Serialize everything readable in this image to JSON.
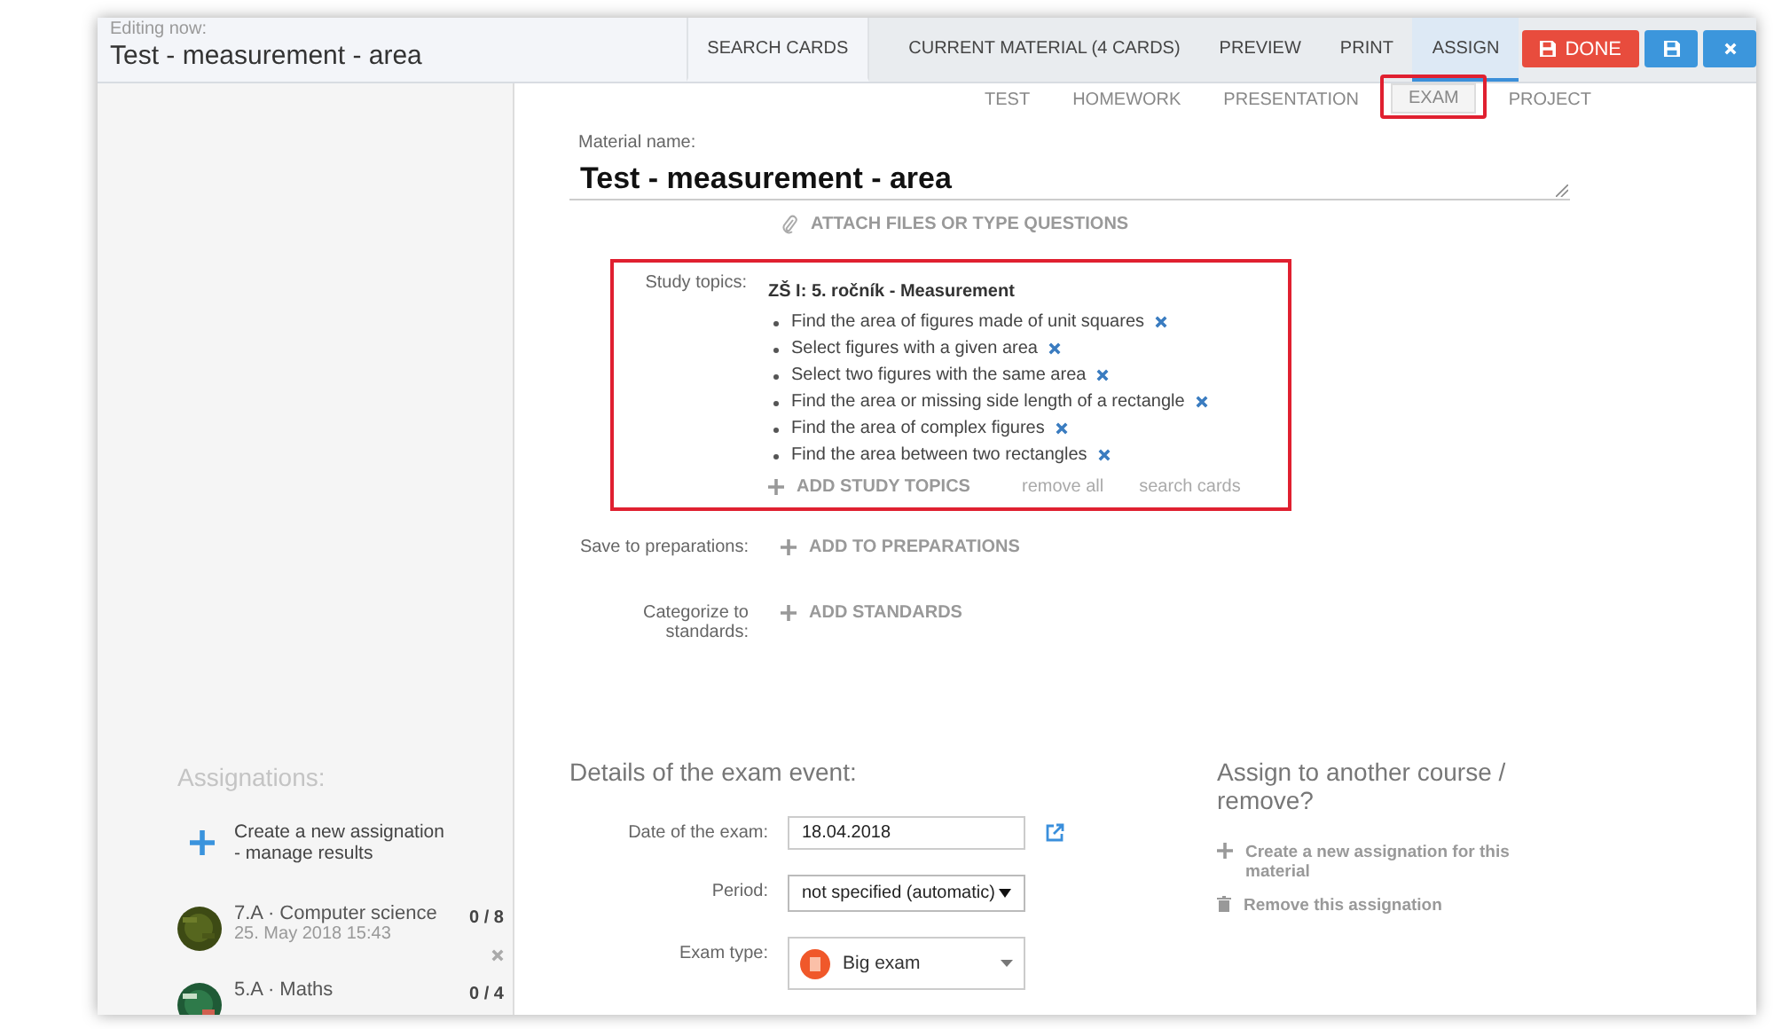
{
  "header": {
    "caption": "Editing now:",
    "title": "Test - measurement - area"
  },
  "nav_tabs": [
    {
      "label": "SEARCH CARDS",
      "selected": false
    },
    {
      "label": "CURRENT MATERIAL (4 CARDS)",
      "selected": false
    },
    {
      "label": "PREVIEW",
      "selected": false
    },
    {
      "label": "PRINT",
      "selected": false
    },
    {
      "label": "ASSIGN",
      "selected": true
    }
  ],
  "actions": {
    "done": "DONE"
  },
  "material_types": [
    {
      "label": "TEST",
      "selected": false
    },
    {
      "label": "HOMEWORK",
      "selected": false
    },
    {
      "label": "PRESENTATION",
      "selected": false
    },
    {
      "label": "EXAM",
      "selected": true
    },
    {
      "label": "PROJECT",
      "selected": false
    }
  ],
  "material_name": {
    "label": "Material name:",
    "value": "Test - measurement - area"
  },
  "attach": "ATTACH FILES OR TYPE QUESTIONS",
  "study_topics": {
    "label": "Study topics:",
    "group": "ZŠ I: 5. ročník - Measurement",
    "topics": [
      "Find the area of figures made of unit squares",
      "Select figures with a given area",
      "Select two figures with the same area",
      "Find the area or missing side length of a rectangle",
      "Find the area of complex figures",
      "Find the area between two rectangles"
    ],
    "add": "ADD STUDY TOPICS",
    "remove_all": "remove all",
    "search": "search cards"
  },
  "preparations": {
    "label": "Save to preparations:",
    "action": "ADD TO PREPARATIONS"
  },
  "standards": {
    "label": "Categorize to standards:",
    "action": "ADD STANDARDS"
  },
  "assignations": {
    "title": "Assignations:",
    "create": "Create a new assignation - manage results",
    "items": [
      {
        "name": "7.A · Computer science",
        "date": "25. May 2018 15:43",
        "score": "0 / 8"
      },
      {
        "name": "5.A · Maths",
        "score": "0 / 4"
      }
    ]
  },
  "exam_event": {
    "title": "Details of the exam event:",
    "date": {
      "label": "Date of the exam:",
      "value": "18.04.2018"
    },
    "period": {
      "label": "Period:",
      "value": "not specified (automatic)"
    },
    "exam_type": {
      "label": "Exam type:",
      "value": "Big exam"
    }
  },
  "reassign": {
    "title": "Assign to another course / remove?",
    "actions": [
      {
        "kind": "create",
        "label": "Create a new assignation for this material"
      },
      {
        "kind": "remove",
        "label": "Remove this assignation"
      }
    ]
  }
}
